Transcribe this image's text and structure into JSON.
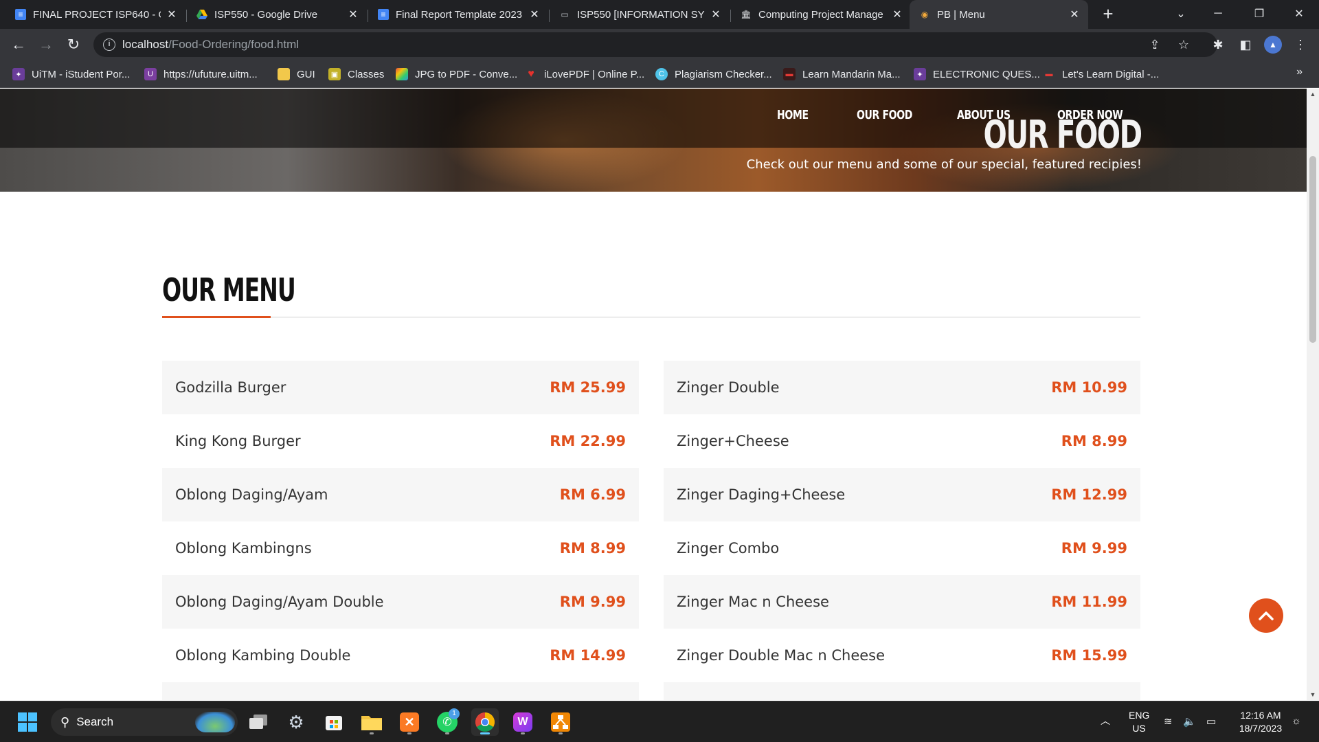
{
  "browser": {
    "tabs": [
      {
        "title": "FINAL PROJECT ISP640 - Go",
        "icon": "google-docs-icon"
      },
      {
        "title": "ISP550 - Google Drive",
        "icon": "google-drive-icon"
      },
      {
        "title": "Final Report Template 2023",
        "icon": "google-docs-icon"
      },
      {
        "title": "ISP550 [INFORMATION SYS",
        "icon": "laptop-icon"
      },
      {
        "title": "Computing Project Manage",
        "icon": "institution-icon"
      },
      {
        "title": "PB | Menu",
        "icon": "site-favicon"
      }
    ],
    "active_tab_index": 5,
    "url_host": "localhost",
    "url_path": "/Food-Ordering/food.html",
    "bookmarks": [
      "UiTM - iStudent Por...",
      "https://ufuture.uitm...",
      "GUI",
      "Classes",
      "JPG to PDF - Conve...",
      "iLovePDF | Online P...",
      "Plagiarism Checker...",
      "Learn Mandarin Ma...",
      "ELECTRONIC QUES...",
      "Let's Learn Digital -..."
    ],
    "bookmarks_more": "»"
  },
  "site": {
    "nav": [
      "HOME",
      "OUR FOOD",
      "ABOUT US",
      "ORDER NOW"
    ],
    "hero_title": "OUR FOOD",
    "hero_subtitle": "Check out our menu and some of our special, featured recipies!",
    "menu_heading": "OUR MENU",
    "menu_left": [
      {
        "name": "Godzilla Burger",
        "price": "RM 25.99"
      },
      {
        "name": "King Kong Burger",
        "price": "RM 22.99"
      },
      {
        "name": "Oblong Daging/Ayam",
        "price": "RM 6.99"
      },
      {
        "name": "Oblong Kambingns",
        "price": "RM 8.99"
      },
      {
        "name": "Oblong Daging/Ayam Double",
        "price": "RM 9.99"
      },
      {
        "name": "Oblong Kambing Double",
        "price": "RM 14.99"
      }
    ],
    "menu_right": [
      {
        "name": "Zinger Double",
        "price": "RM 10.99"
      },
      {
        "name": "Zinger+Cheese",
        "price": "RM 8.99"
      },
      {
        "name": "Zinger Daging+Cheese",
        "price": "RM 12.99"
      },
      {
        "name": "Zinger Combo",
        "price": "RM 9.99"
      },
      {
        "name": "Zinger Mac n Cheese",
        "price": "RM 11.99"
      },
      {
        "name": "Zinger Double Mac n Cheese",
        "price": "RM 15.99"
      }
    ],
    "accent_color": "#e0501c"
  },
  "taskbar": {
    "search_label": "Search",
    "lang_line1": "ENG",
    "lang_line2": "US",
    "time": "12:16 AM",
    "date": "18/7/2023",
    "whatsapp_badge": "1"
  }
}
